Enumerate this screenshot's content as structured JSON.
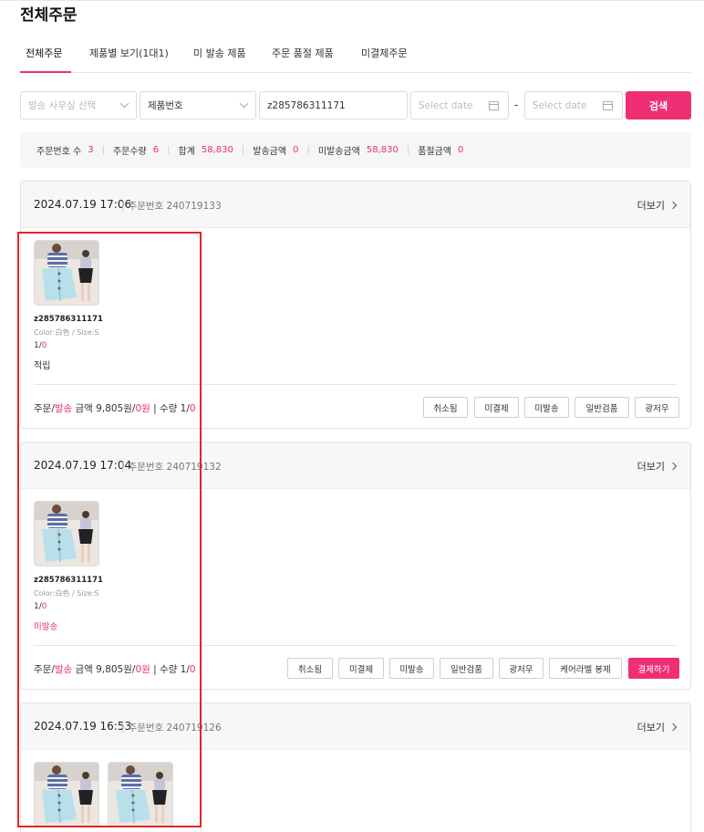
{
  "page": {
    "title": "전체주문"
  },
  "tabs": [
    {
      "label": "전체주문",
      "active": true
    },
    {
      "label": "제품별 보기(1대1)"
    },
    {
      "label": "미 발송 제품"
    },
    {
      "label": "주문 품절 제품"
    },
    {
      "label": "미결제주문"
    }
  ],
  "filters": {
    "office_placeholder": "발송 사무실 선택",
    "product_field": "제품번호",
    "keyword_value": "z285786311171",
    "start_date_placeholder": "Select date",
    "end_date_placeholder": "Select date",
    "range_separator": "-",
    "search_label": "검색"
  },
  "summary": [
    {
      "label": "주문번호 수",
      "value": "3"
    },
    {
      "label": "주문수량",
      "value": "6"
    },
    {
      "label": "합계",
      "value": "58,830"
    },
    {
      "label": "발송금액",
      "value": "0"
    },
    {
      "label": "미발송금액",
      "value": "58,830"
    },
    {
      "label": "품절금액",
      "value": "0"
    }
  ],
  "orders": [
    {
      "date": "2024.07.19 17:06",
      "order_no": "주문번호 240719133",
      "more": "더보기",
      "product": {
        "code": "z285786311171",
        "option": "Color:白色 / Size:S",
        "qty_a": "1/",
        "qty_b": "0",
        "status": "적립"
      },
      "footer": {
        "a": "주문/",
        "b": "발송",
        "c": "  금액 9,805원/",
        "d": "0원",
        "e": "  |  수량 1/",
        "f": "0"
      },
      "actions": [
        "취소됨",
        "미결제",
        "미발송",
        "일반검품",
        "광저우"
      ]
    },
    {
      "date": "2024.07.19 17:04",
      "order_no": "주문번호 240719132",
      "more": "더보기",
      "product": {
        "code": "z285786311171",
        "option": "Color:白色 / Size:S",
        "qty_a": "1/",
        "qty_b": "0",
        "status": "미발송"
      },
      "footer": {
        "a": "주문/",
        "b": "발송",
        "c": "  금액 9,805원/",
        "d": "0원",
        "e": "  |  수량 1/",
        "f": "0"
      },
      "actions": [
        "취소됨",
        "미결제",
        "미발송",
        "일반검품",
        "광저우",
        "케어라벨 봉제",
        "결제하기"
      ]
    },
    {
      "date": "2024.07.19 16:53",
      "order_no": "주문번호 240719126",
      "more": "더보기"
    }
  ]
}
